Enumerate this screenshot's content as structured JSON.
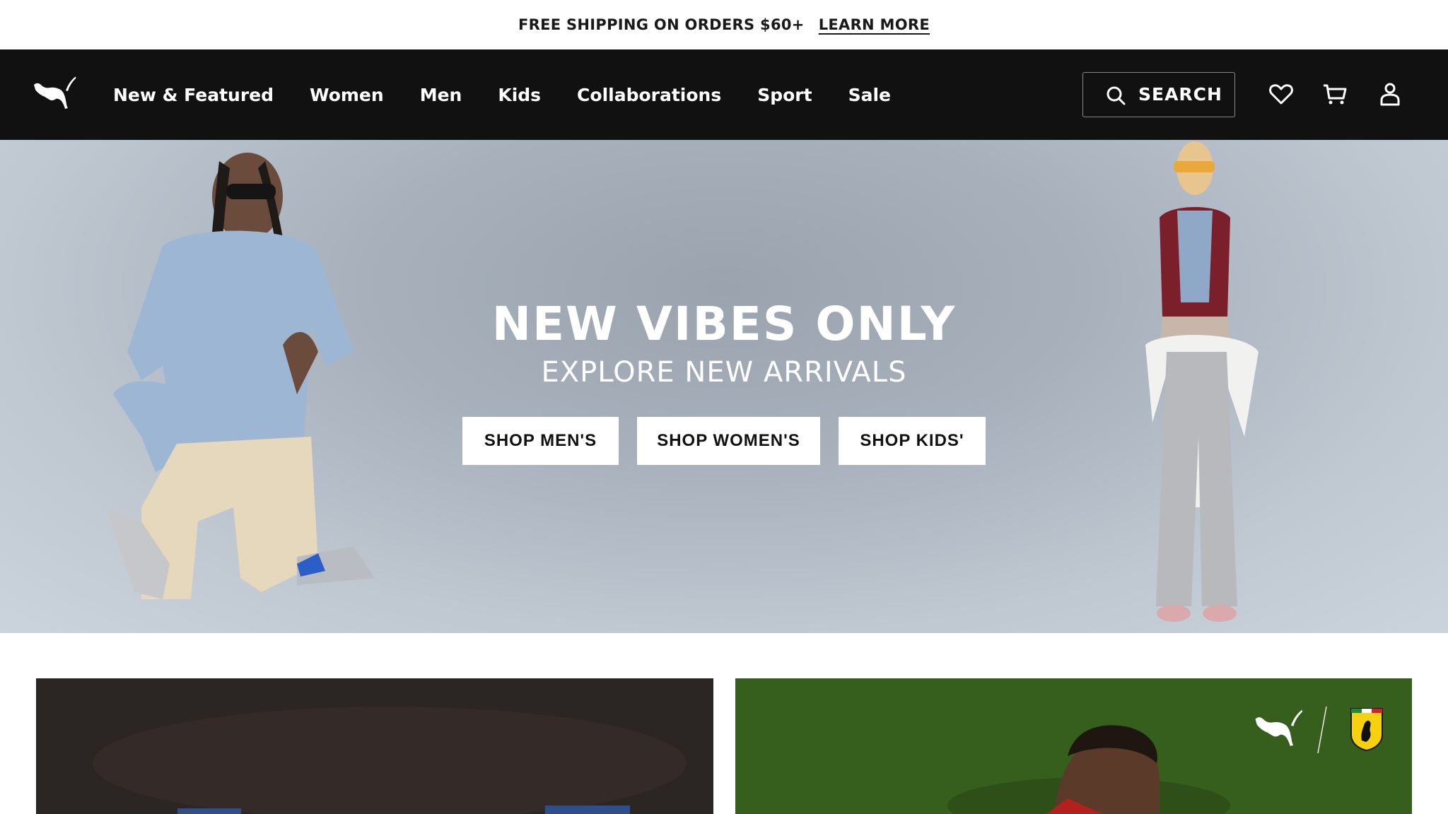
{
  "promo": {
    "text": "FREE SHIPPING ON ORDERS $60+",
    "link": "LEARN MORE"
  },
  "nav": {
    "logo": "puma-logo-icon",
    "menu": [
      "New & Featured",
      "Women",
      "Men",
      "Kids",
      "Collaborations",
      "Sport",
      "Sale"
    ],
    "search_label": "SEARCH",
    "icons": [
      "search-icon",
      "heart-icon",
      "cart-icon",
      "user-icon"
    ]
  },
  "hero": {
    "title": "NEW VIBES ONLY",
    "subtitle": "EXPLORE NEW ARRIVALS",
    "buttons": [
      "SHOP MEN'S",
      "SHOP WOMEN'S",
      "SHOP KIDS'"
    ]
  },
  "cards": [
    {
      "image": "dark-promo-photo"
    },
    {
      "image": "ferrari-puma-promo-photo",
      "logos": [
        "puma-logo-icon",
        "ferrari-shield-icon"
      ]
    }
  ],
  "colors": {
    "nav_bg": "#111111",
    "hero_bg": "#a7b0bb",
    "button_bg": "#ffffff",
    "text_white": "#ffffff"
  }
}
